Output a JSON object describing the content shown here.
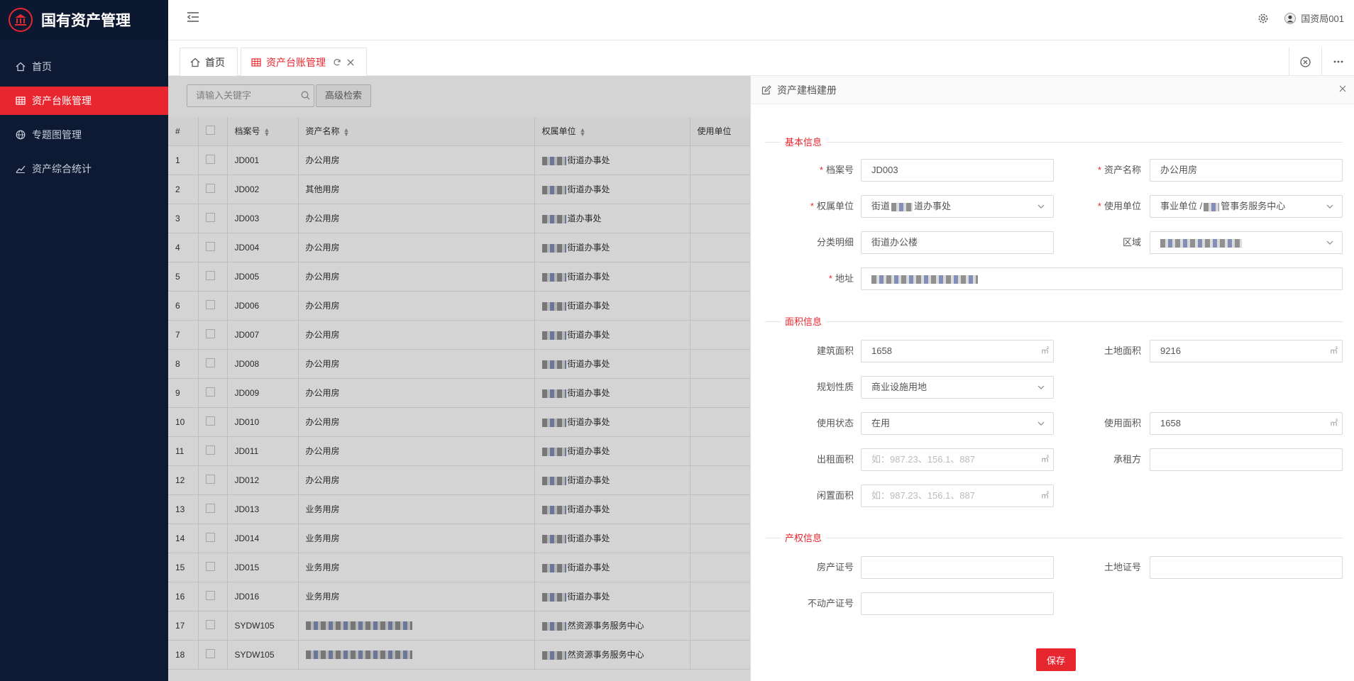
{
  "app": {
    "title": "国有资产管理"
  },
  "sidebar": {
    "items": [
      {
        "label": "首页",
        "icon": "home-icon",
        "active": false
      },
      {
        "label": "资产台账管理",
        "icon": "table-icon",
        "active": true
      },
      {
        "label": "专题图管理",
        "icon": "globe-icon",
        "active": false
      },
      {
        "label": "资产综合统计",
        "icon": "chart-line-icon",
        "active": false
      }
    ]
  },
  "header": {
    "user_name": "国资局001"
  },
  "tabs": [
    {
      "label": "首页",
      "icon": "home-icon"
    },
    {
      "label": "资产台账管理",
      "icon": "table-icon",
      "active": true
    }
  ],
  "search": {
    "placeholder": "请输入关键字",
    "advanced_label": "高级检索"
  },
  "table": {
    "headers": [
      "#",
      "",
      "档案号",
      "资产名称",
      "权属单位",
      "使用单位"
    ],
    "rows": [
      {
        "n": "1",
        "id": "JD001",
        "name": "办公用房",
        "owner": "街道办事处"
      },
      {
        "n": "2",
        "id": "JD002",
        "name": "其他用房",
        "owner": "街道办事处"
      },
      {
        "n": "3",
        "id": "JD003",
        "name": "办公用房",
        "owner": "道办事处"
      },
      {
        "n": "4",
        "id": "JD004",
        "name": "办公用房",
        "owner": "街道办事处"
      },
      {
        "n": "5",
        "id": "JD005",
        "name": "办公用房",
        "owner": "街道办事处"
      },
      {
        "n": "6",
        "id": "JD006",
        "name": "办公用房",
        "owner": "街道办事处"
      },
      {
        "n": "7",
        "id": "JD007",
        "name": "办公用房",
        "owner": "街道办事处"
      },
      {
        "n": "8",
        "id": "JD008",
        "name": "办公用房",
        "owner": "街道办事处"
      },
      {
        "n": "9",
        "id": "JD009",
        "name": "办公用房",
        "owner": "街道办事处"
      },
      {
        "n": "10",
        "id": "JD010",
        "name": "办公用房",
        "owner": "街道办事处"
      },
      {
        "n": "11",
        "id": "JD011",
        "name": "办公用房",
        "owner": "街道办事处"
      },
      {
        "n": "12",
        "id": "JD012",
        "name": "办公用房",
        "owner": "街道办事处"
      },
      {
        "n": "13",
        "id": "JD013",
        "name": "业务用房",
        "owner": "街道办事处"
      },
      {
        "n": "14",
        "id": "JD014",
        "name": "业务用房",
        "owner": "街道办事处"
      },
      {
        "n": "15",
        "id": "JD015",
        "name": "业务用房",
        "owner": "街道办事处"
      },
      {
        "n": "16",
        "id": "JD016",
        "name": "业务用房",
        "owner": "街道办事处"
      },
      {
        "n": "17",
        "id": "SYDW105",
        "name": "",
        "owner": "然资源事务服务中心"
      },
      {
        "n": "18",
        "id": "SYDW105",
        "name": "",
        "owner": "然资源事务服务中心"
      }
    ]
  },
  "drawer": {
    "title": "资产建档建册",
    "sections": {
      "basic": "基本信息",
      "area": "面积信息",
      "property": "产权信息"
    },
    "labels": {
      "archive_no": "档案号",
      "asset_name": "资产名称",
      "owner_unit": "权属单位",
      "use_unit": "使用单位",
      "category": "分类明细",
      "region": "区域",
      "address": "地址",
      "building_area": "建筑面积",
      "land_area": "土地面积",
      "planning": "规划性质",
      "use_status": "使用状态",
      "use_area": "使用面积",
      "rent_area": "出租面积",
      "tenant": "承租方",
      "idle_area": "闲置面积",
      "house_cert": "房产证号",
      "land_cert": "土地证号",
      "estate_cert": "不动产证号"
    },
    "values": {
      "archive_no": "JD003",
      "asset_name": "办公用房",
      "owner_unit_a": "街道",
      "owner_unit_b": "道办事处",
      "use_unit_a": "事业单位 /",
      "use_unit_b": "管事务服务中心",
      "category": "街道办公楼",
      "building_area": "1658",
      "land_area": "9216",
      "planning": "商业设施用地",
      "use_status": "在用",
      "use_area": "1658"
    },
    "unit": "㎡",
    "rent_placeholder": "如：987.23、156.1、887",
    "idle_placeholder": "如：987.23、156.1、887",
    "save_label": "保存"
  }
}
